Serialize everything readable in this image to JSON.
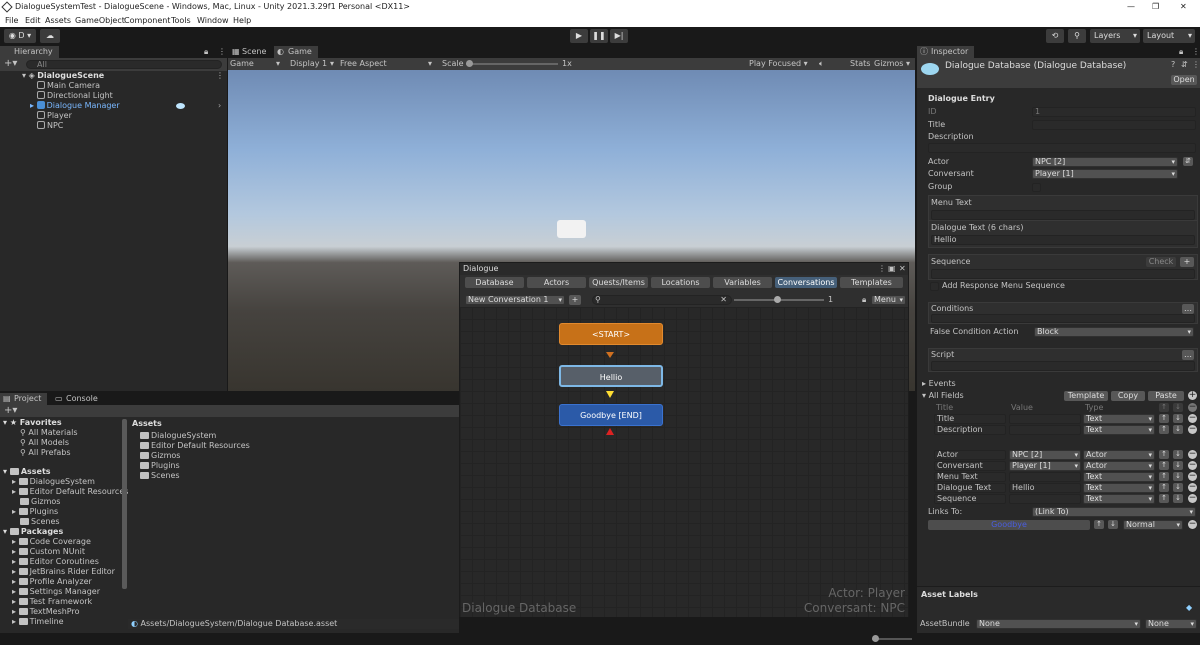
{
  "window": {
    "title": "DialogueSystemTest - DialogueScene - Windows, Mac, Linux - Unity 2021.3.29f1 Personal <DX11>"
  },
  "menu": [
    "File",
    "Edit",
    "Assets",
    "GameObject",
    "Component",
    "Tools",
    "Window",
    "Help"
  ],
  "toolbar": {
    "account": "D",
    "layers": "Layers",
    "layout": "Layout"
  },
  "hierarchy": {
    "tab": "Hierarchy",
    "search_placeholder": "All",
    "scene": "DialogueScene",
    "items": [
      "Main Camera",
      "Directional Light",
      "Dialogue Manager",
      "Player",
      "NPC"
    ]
  },
  "scene_tabs": {
    "scene": "Scene",
    "game": "Game"
  },
  "game_bar": {
    "display_mode": "Game",
    "display": "Display 1",
    "aspect": "Free Aspect",
    "scale_label": "Scale",
    "scale_value": "1x",
    "play_focused": "Play Focused",
    "stats": "Stats",
    "gizmos": "Gizmos"
  },
  "dialogue": {
    "title": "Dialogue",
    "tabs": [
      "Database",
      "Actors",
      "Quests/Items",
      "Locations",
      "Variables",
      "Conversations",
      "Templates"
    ],
    "active_tab": "Conversations",
    "conversation": "New Conversation 1",
    "add": "+",
    "zoom": "1",
    "menu": "Menu",
    "nodes": {
      "start": "<START>",
      "hello": "Hellio",
      "goodbye": "Goodbye [END]"
    },
    "footer_db": "Dialogue Database",
    "actor_line": "Actor: Player",
    "conversant_line": "Conversant: NPC"
  },
  "project": {
    "tabs": [
      "Project",
      "Console"
    ],
    "favorites_label": "Favorites",
    "favorites": [
      "All Materials",
      "All Models",
      "All Prefabs"
    ],
    "assets_label": "Assets",
    "assets": [
      "DialogueSystem",
      "Editor Default Resources",
      "Gizmos",
      "Plugins",
      "Scenes"
    ],
    "packages_label": "Packages",
    "packages": [
      "Code Coverage",
      "Custom NUnit",
      "Editor Coroutines",
      "JetBrains Rider Editor",
      "Profile Analyzer",
      "Settings Manager",
      "Test Framework",
      "TextMeshPro",
      "Timeline"
    ],
    "grid_header": "Assets",
    "grid_items": [
      "DialogueSystem",
      "Editor Default Resources",
      "Gizmos",
      "Plugins",
      "Scenes"
    ],
    "path": "Assets/DialogueSystem/Dialogue Database.asset"
  },
  "inspector": {
    "tab": "Inspector",
    "header": "Dialogue Database (Dialogue Database)",
    "open": "Open",
    "section": "Dialogue Entry",
    "id_label": "ID",
    "id_value": "1",
    "title_label": "Title",
    "description_label": "Description",
    "actor_label": "Actor",
    "actor_value": "NPC [2]",
    "conversant_label": "Conversant",
    "conversant_value": "Player [1]",
    "group_label": "Group",
    "menu_text_label": "Menu Text",
    "dialogue_text_label": "Dialogue Text (6 chars)",
    "dialogue_text_value": "Hellio",
    "sequence_label": "Sequence",
    "check": "Check",
    "plus": "+",
    "add_response": "Add Response Menu Sequence",
    "conditions_label": "Conditions",
    "false_condition_label": "False Condition Action",
    "false_condition_value": "Block",
    "script_label": "Script",
    "events_label": "Events",
    "all_fields_label": "All Fields",
    "template_btn": "Template",
    "copy_btn": "Copy",
    "paste_btn": "Paste",
    "fields_header": [
      "Title",
      "Value",
      "Type"
    ],
    "fields_top": [
      {
        "title": "Title",
        "value": "",
        "type": "Text"
      },
      {
        "title": "Description",
        "value": "",
        "type": "Text"
      }
    ],
    "fields_bottom": [
      {
        "title": "Actor",
        "value": "NPC [2]",
        "type": "Actor"
      },
      {
        "title": "Conversant",
        "value": "Player [1]",
        "type": "Actor"
      },
      {
        "title": "Menu Text",
        "value": "",
        "type": "Text"
      },
      {
        "title": "Dialogue Text",
        "value": "Hellio",
        "type": "Text"
      },
      {
        "title": "Sequence",
        "value": "",
        "type": "Text"
      }
    ],
    "links_to_label": "Links To:",
    "links_to_value": "(Link To)",
    "link_target": "Goodbye",
    "link_priority": "Normal",
    "asset_labels": "Asset Labels",
    "asset_bundle_label": "AssetBundle",
    "asset_bundle_value": "None",
    "asset_bundle_variant": "None"
  }
}
